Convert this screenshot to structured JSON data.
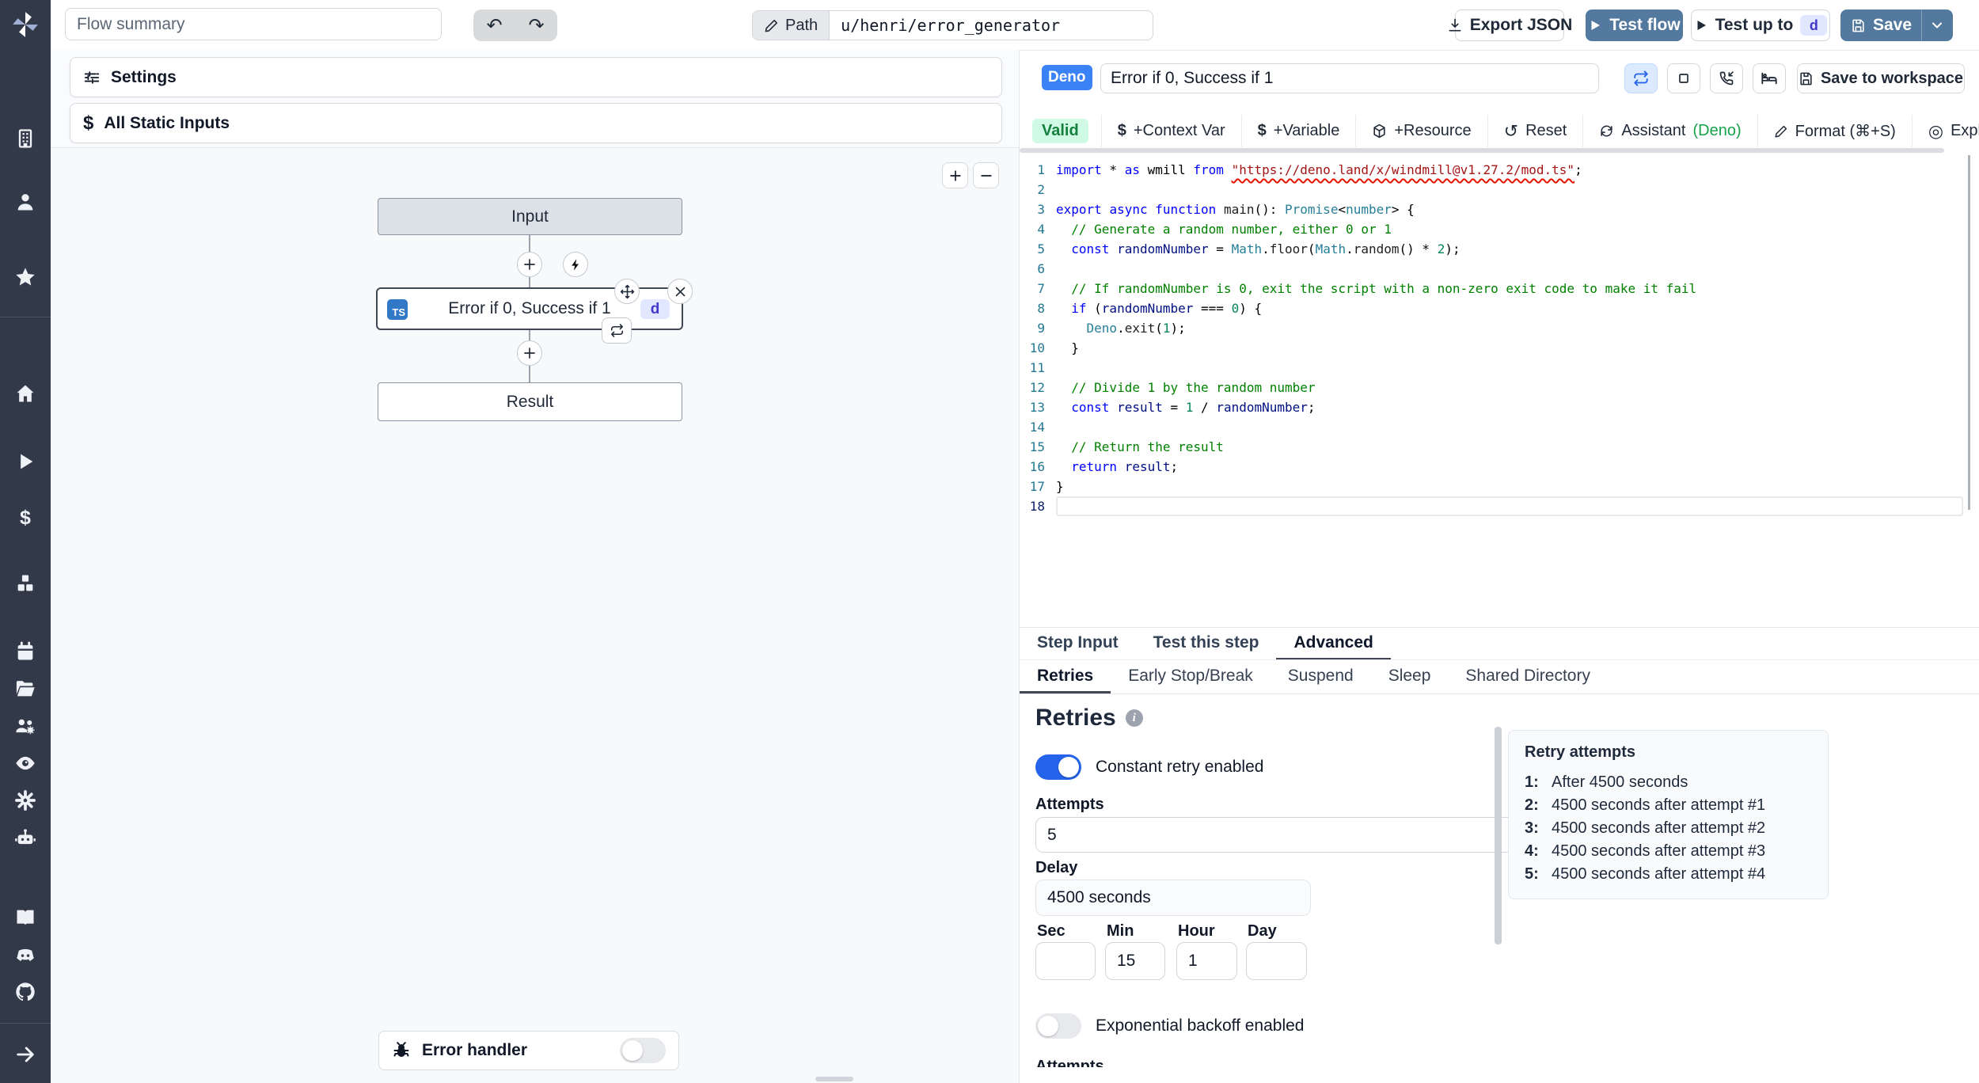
{
  "colors": {
    "sidebar_bg": "#323949",
    "steel_blue_button": "#54799e",
    "accent_blue": "#3b82f6",
    "toggle_on_blue": "#2563eb",
    "valid_green_bg": "#d1fae5",
    "valid_green_text": "#15803d",
    "indigo_badge_bg": "#e0e7ff",
    "indigo_badge_text": "#4338ca",
    "ts_badge_blue": "#3178c6"
  },
  "sidebar": {
    "icons": [
      "workspace-building",
      "user",
      "favorites-star",
      "home",
      "runs-play",
      "variables-dollar",
      "resources-cubes",
      "schedules-calendar",
      "folders",
      "groups",
      "audit-eye",
      "workspace-settings-gear",
      "workers-robot",
      "docs-book",
      "discord",
      "github",
      "collapse-arrow"
    ]
  },
  "topbar": {
    "flow_summary": "Flow summary",
    "path_label": "Path",
    "path_value": "u/henri/error_generator",
    "export_json_label": "Export JSON",
    "test_flow_label": "Test flow",
    "test_up_to_label": "Test up to",
    "test_up_to_step": "d",
    "save_label": "Save"
  },
  "left": {
    "settings_label": "Settings",
    "static_inputs_label": "All Static Inputs",
    "zoom_in": "+",
    "zoom_out": "−",
    "flow": {
      "input_label": "Input",
      "step_lang": "TS",
      "step_label": "Error if 0, Success if 1",
      "step_id": "d",
      "result_label": "Result",
      "error_handler_label": "Error handler",
      "error_handler_enabled": false
    }
  },
  "right": {
    "lang_badge": "Deno",
    "step_name": "Error if 0, Success if 1",
    "save_to_workspace": "Save to workspace",
    "toolbar": {
      "valid": "Valid",
      "context_var": "+Context Var",
      "variable": "+Variable",
      "resource": "+Resource",
      "reset": "Reset",
      "assistant": "Assistant",
      "assistant_lang": "(Deno)",
      "format": "Format (⌘+S)",
      "explore": "Explore other s"
    },
    "tabs": [
      "Step Input",
      "Test this step",
      "Advanced"
    ],
    "active_tab": "Advanced",
    "subtabs": [
      "Retries",
      "Early Stop/Break",
      "Suspend",
      "Sleep",
      "Shared Directory"
    ],
    "active_subtab": "Retries",
    "retries": {
      "title": "Retries",
      "constant_toggle_label": "Constant retry enabled",
      "constant_enabled": true,
      "attempts_label": "Attempts",
      "attempts_value": "5",
      "delay_label": "Delay",
      "delay_value": "4500 seconds",
      "time_fields": [
        {
          "label": "Sec",
          "value": ""
        },
        {
          "label": "Min",
          "value": "15"
        },
        {
          "label": "Hour",
          "value": "1"
        },
        {
          "label": "Day",
          "value": ""
        }
      ],
      "exponential_toggle_label": "Exponential backoff enabled",
      "exponential_enabled": false,
      "clipped_label": "Attempts",
      "preview": {
        "title": "Retry attempts",
        "items": [
          {
            "n": "1:",
            "text": "After 4500 seconds"
          },
          {
            "n": "2:",
            "text": "4500 seconds after attempt #1"
          },
          {
            "n": "3:",
            "text": "4500 seconds after attempt #2"
          },
          {
            "n": "4:",
            "text": "4500 seconds after attempt #3"
          },
          {
            "n": "5:",
            "text": "4500 seconds after attempt #4"
          }
        ]
      }
    }
  },
  "code": {
    "active_line": 18,
    "lines": [
      [
        [
          "kw",
          "import"
        ],
        [
          "pl",
          " * "
        ],
        [
          "kw",
          "as"
        ],
        [
          "pl",
          " wmill "
        ],
        [
          "kw",
          "from"
        ],
        [
          "pl",
          " "
        ],
        [
          "str sq",
          "\"https://deno.land/x/windmill@v1.27.2/mod.ts\""
        ],
        [
          "pl",
          ";"
        ]
      ],
      [],
      [
        [
          "kw",
          "export"
        ],
        [
          "pl",
          " "
        ],
        [
          "kw",
          "async"
        ],
        [
          "pl",
          " "
        ],
        [
          "kw",
          "function"
        ],
        [
          "pl",
          " "
        ],
        [
          "fn",
          "main"
        ],
        [
          "pl",
          "(): "
        ],
        [
          "type",
          "Promise"
        ],
        [
          "pl",
          "<"
        ],
        [
          "type",
          "number"
        ],
        [
          "pl",
          "> {"
        ]
      ],
      [
        [
          "cm",
          "  // Generate a random number, either 0 or 1"
        ]
      ],
      [
        [
          "pl",
          "  "
        ],
        [
          "kw",
          "const"
        ],
        [
          "pl",
          " "
        ],
        [
          "vr",
          "randomNumber"
        ],
        [
          "pl",
          " = "
        ],
        [
          "type",
          "Math"
        ],
        [
          "pl",
          "."
        ],
        [
          "fn",
          "floor"
        ],
        [
          "pl",
          "("
        ],
        [
          "type",
          "Math"
        ],
        [
          "pl",
          "."
        ],
        [
          "fn",
          "random"
        ],
        [
          "pl",
          "() * "
        ],
        [
          "num",
          "2"
        ],
        [
          "pl",
          ");"
        ]
      ],
      [],
      [
        [
          "cm",
          "  // If randomNumber is 0, exit the script with a non-zero exit code to make it fail"
        ]
      ],
      [
        [
          "pl",
          "  "
        ],
        [
          "kw",
          "if"
        ],
        [
          "pl",
          " ("
        ],
        [
          "vr",
          "randomNumber"
        ],
        [
          "pl",
          " === "
        ],
        [
          "num",
          "0"
        ],
        [
          "pl",
          ") {"
        ]
      ],
      [
        [
          "pl",
          "    "
        ],
        [
          "type",
          "Deno"
        ],
        [
          "pl",
          "."
        ],
        [
          "fn",
          "exit"
        ],
        [
          "pl",
          "("
        ],
        [
          "num",
          "1"
        ],
        [
          "pl",
          ");"
        ]
      ],
      [
        [
          "pl",
          "  }"
        ]
      ],
      [],
      [
        [
          "cm",
          "  // Divide 1 by the random number"
        ]
      ],
      [
        [
          "pl",
          "  "
        ],
        [
          "kw",
          "const"
        ],
        [
          "pl",
          " "
        ],
        [
          "vr",
          "result"
        ],
        [
          "pl",
          " = "
        ],
        [
          "num",
          "1"
        ],
        [
          "pl",
          " / "
        ],
        [
          "vr",
          "randomNumber"
        ],
        [
          "pl",
          ";"
        ]
      ],
      [],
      [
        [
          "cm",
          "  // Return the result"
        ]
      ],
      [
        [
          "pl",
          "  "
        ],
        [
          "kw",
          "return"
        ],
        [
          "pl",
          " "
        ],
        [
          "vr",
          "result"
        ],
        [
          "pl",
          ";"
        ]
      ],
      [
        [
          "pl",
          "}"
        ]
      ],
      []
    ]
  }
}
